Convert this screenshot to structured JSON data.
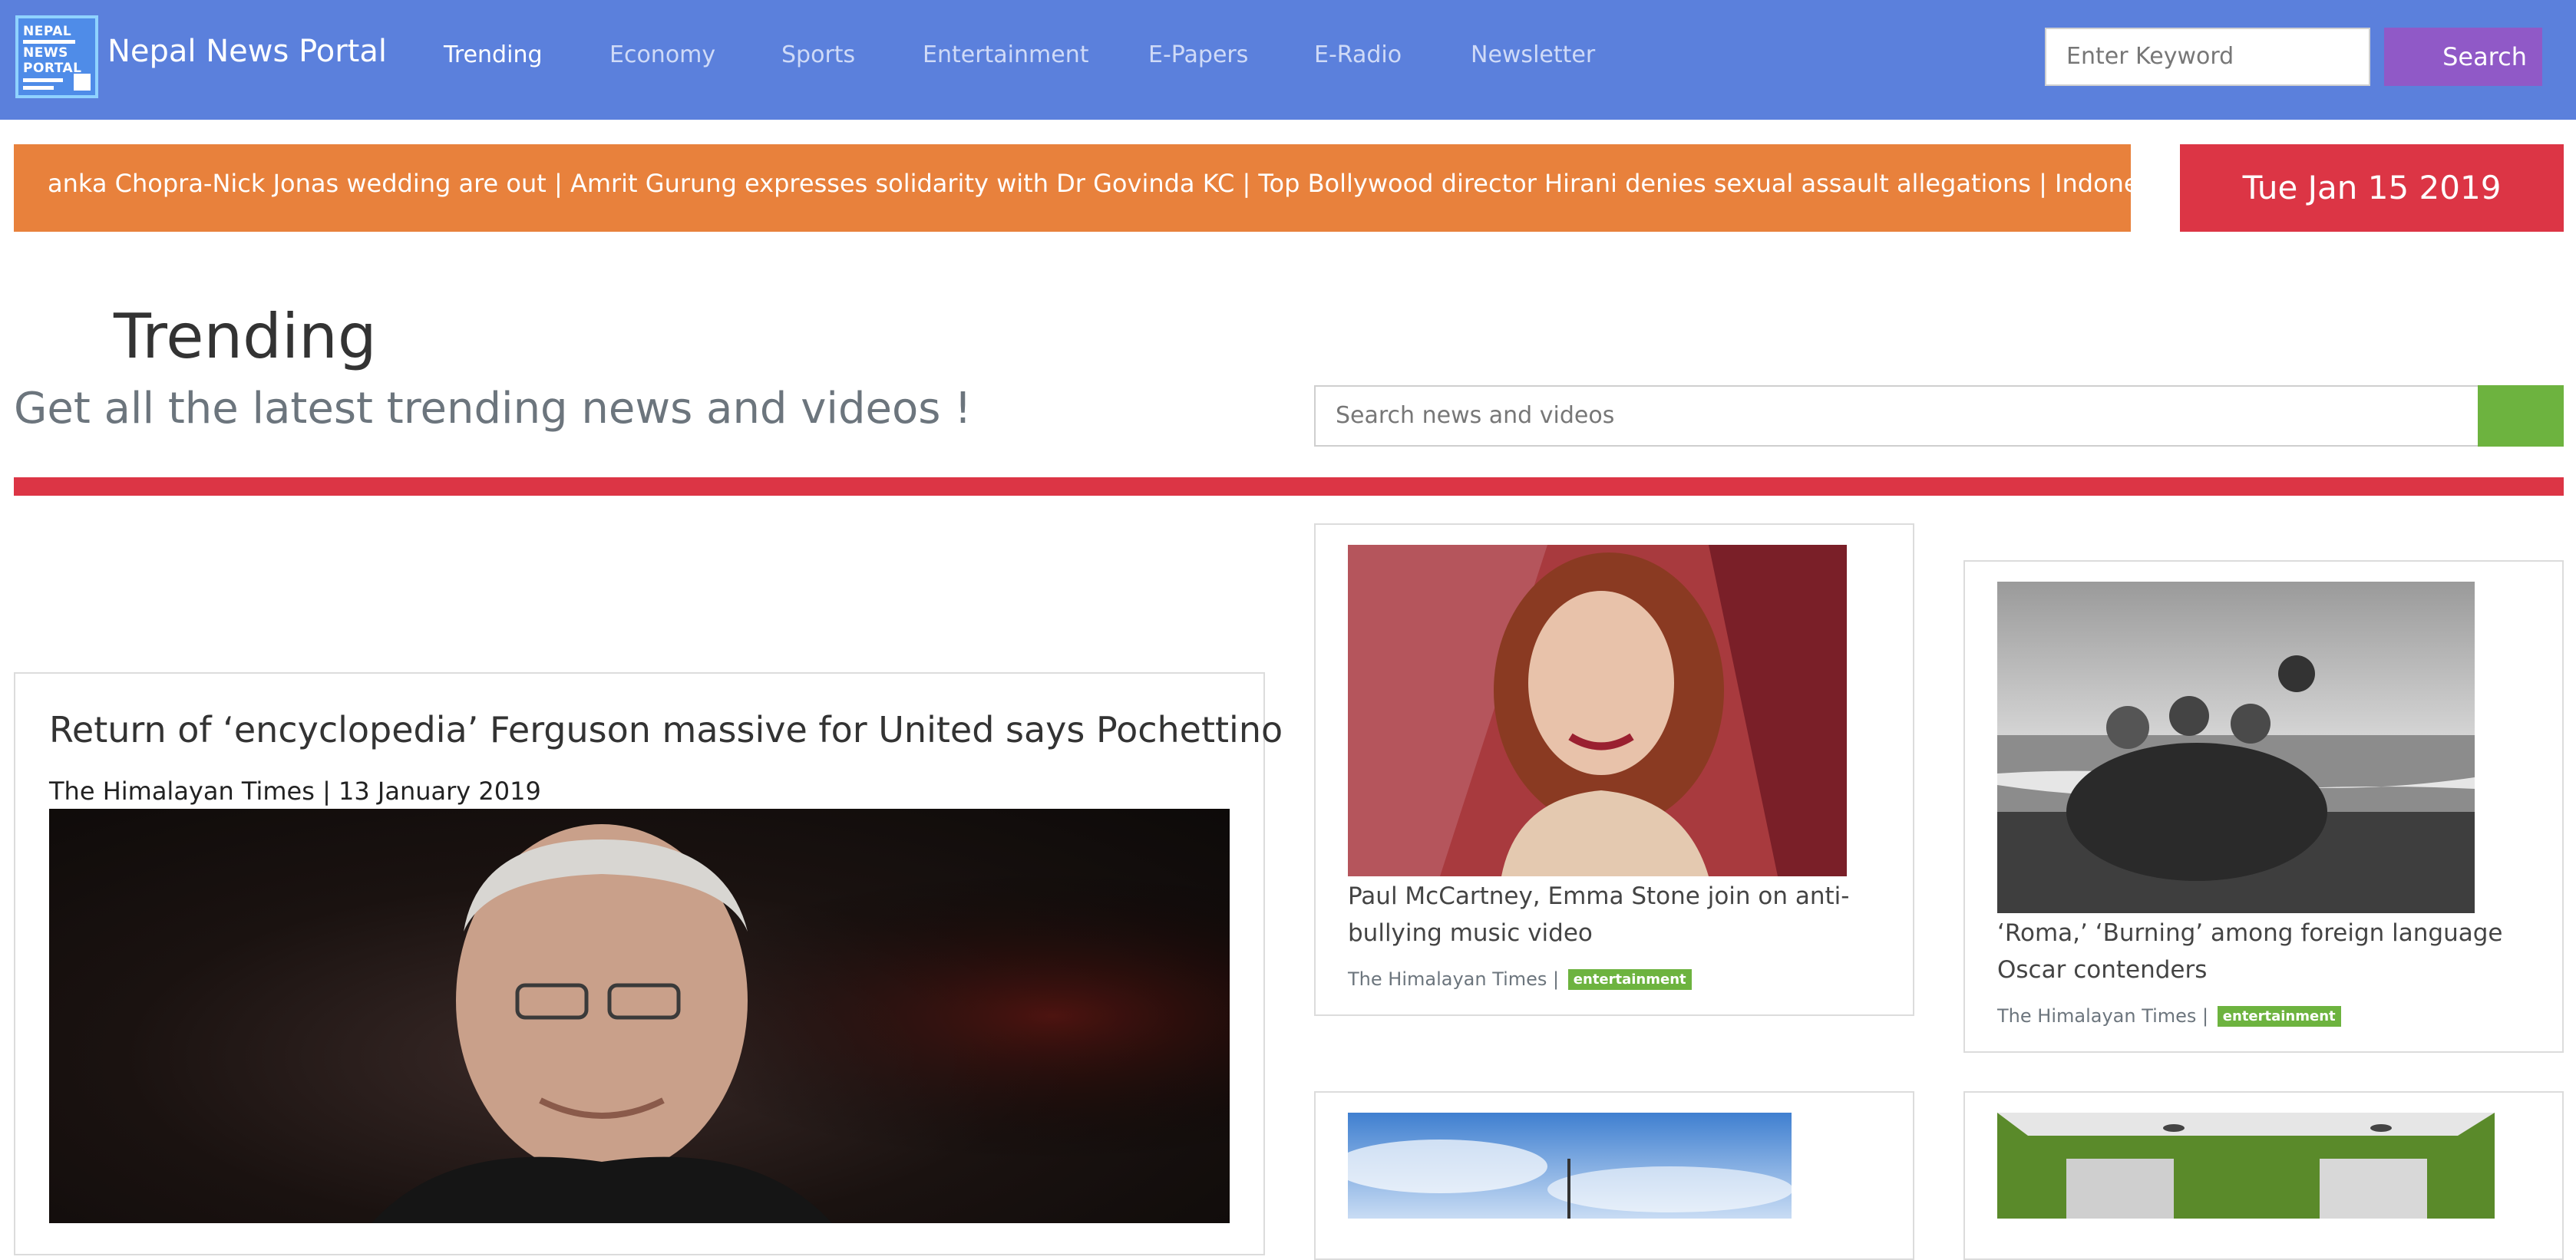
{
  "header": {
    "brand": "Nepal News Portal",
    "logo_lines": [
      "NEPAL",
      "NEWS",
      "PORTAL"
    ],
    "nav": [
      "Trending",
      "Economy",
      "Sports",
      "Entertainment",
      "E-Papers",
      "E-Radio",
      "Newsletter"
    ],
    "active_nav": "Trending",
    "keyword_placeholder": "Enter Keyword",
    "search_label": "Search"
  },
  "ticker": {
    "text": "anka Chopra-Nick Jonas wedding are out | Amrit Gurung expresses solidarity with Dr Govinda KC | Top Bollywood director Hirani denies sexual assault allegations | Indonesia finds Lion Air jet"
  },
  "date": "Tue Jan 15 2019",
  "page": {
    "title": "Trending",
    "subtitle": "Get all the latest trending news and videos !",
    "search_placeholder": "Search news and videos"
  },
  "featured": {
    "title": "Return of ‘encyclopedia’ Ferguson massive for United says Pochettino",
    "meta": "The Himalayan Times | 13 January 2019"
  },
  "cards": [
    {
      "title": "Paul McCartney, Emma Stone join on anti-bullying music video",
      "source": "The Himalayan Times |",
      "tag": "entertainment"
    },
    {
      "title": "‘Roma,’ ‘Burning’ among foreign language Oscar contenders",
      "source": "The Himalayan Times |",
      "tag": "entertainment"
    }
  ],
  "colors": {
    "navbar": "#5b80dc",
    "ticker": "#e8813c",
    "date": "#dc3545",
    "search_button": "#9059c7",
    "badge": "#6db33f",
    "divider": "#dc3545"
  }
}
